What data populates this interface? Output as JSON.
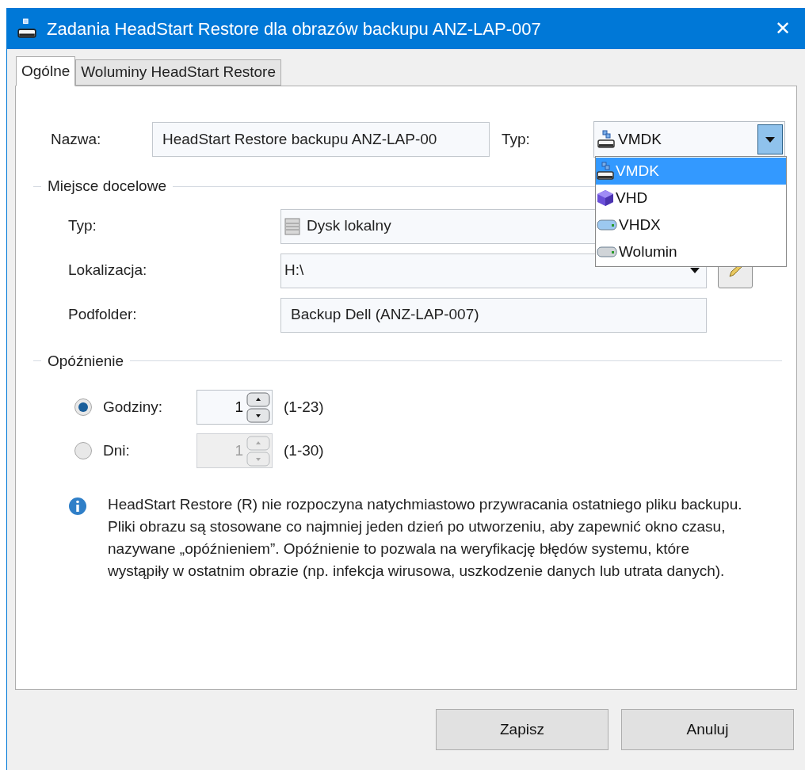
{
  "window": {
    "title": "Zadania HeadStart Restore dla obrazów backupu ANZ-LAP-007",
    "close": "✕"
  },
  "tabs": [
    {
      "label": "Ogólne",
      "selected": true
    },
    {
      "label": "Woluminy HeadStart Restore",
      "selected": false
    }
  ],
  "name": {
    "label": "Nazwa:",
    "value": "HeadStart Restore backupu ANZ-LAP-00"
  },
  "type": {
    "label": "Typ:",
    "value": "VMDK",
    "expanded": true,
    "options": [
      {
        "label": "VMDK",
        "kind": "vmdk",
        "selected": true
      },
      {
        "label": "VHD",
        "kind": "vhd",
        "selected": false
      },
      {
        "label": "VHDX",
        "kind": "vhdx",
        "selected": false
      },
      {
        "label": "Wolumin",
        "kind": "volume",
        "selected": false
      }
    ]
  },
  "destination": {
    "title": "Miejsce docelowe",
    "type_label": "Typ:",
    "type_value": "Dysk lokalny",
    "location_label": "Lokalizacja:",
    "location_value": "H:\\",
    "subfolder_label": "Podfolder:",
    "subfolder_value": "Backup Dell (ANZ-LAP-007)"
  },
  "delay": {
    "title": "Opóźnienie",
    "options": [
      {
        "label": "Godziny:",
        "value": "1",
        "range": "(1-23)",
        "selected": true
      },
      {
        "label": "Dni:",
        "value": "1",
        "range": "(1-30)",
        "selected": false
      }
    ]
  },
  "info": "HeadStart Restore (R) nie rozpoczyna natychmiastowo przywracania ostatniego pliku backupu. Pliki obrazu są stosowane co najmniej jeden dzień po utworzeniu, aby zapewnić okno czasu, nazywane „opóźnieniem”. Opóźnienie to pozwala na weryfikację błędów systemu, które wystąpiły w ostatnim obrazie (np. infekcja wirusowa, uszkodzenie danych lub utrata danych).",
  "buttons": [
    "Zapisz",
    "Anuluj"
  ]
}
